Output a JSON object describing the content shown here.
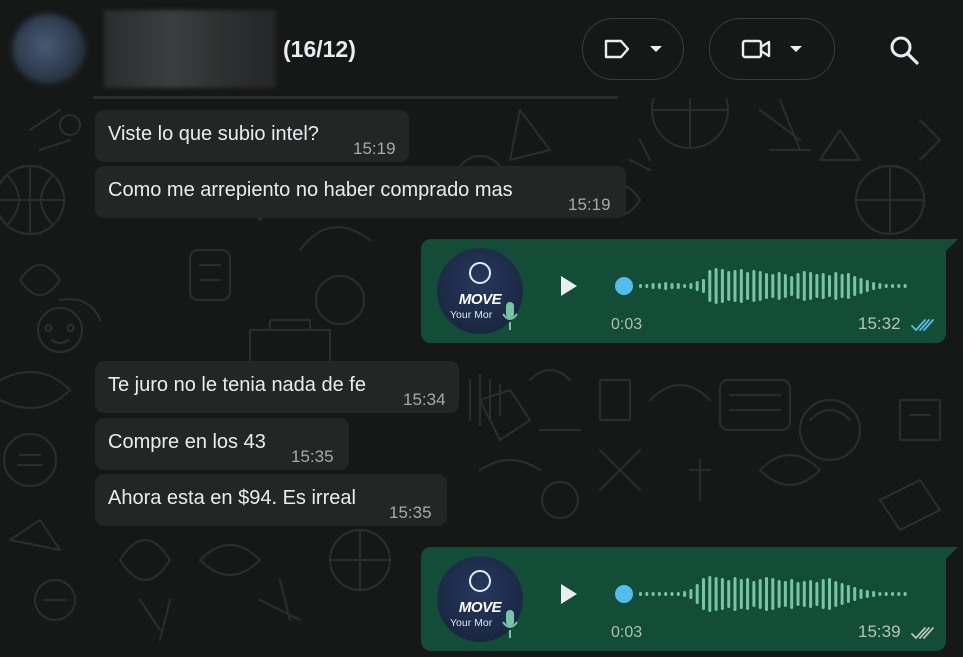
{
  "header": {
    "chat_title": "(16/12)",
    "icons": [
      "label-icon",
      "chevron-down-icon",
      "video-call-icon",
      "chevron-down-icon",
      "search-icon"
    ]
  },
  "messages_in": [
    {
      "text": "Viste lo que subio intel?",
      "time": "15:19"
    },
    {
      "text": "Como me arrepiento no haber comprado mas",
      "time": "15:19"
    },
    {
      "text": "Te juro no le tenia nada de fe",
      "time": "15:34"
    },
    {
      "text": "Compre en los 43",
      "time": "15:35"
    },
    {
      "text": "Ahora esta en $94. Es irreal",
      "time": "15:35"
    }
  ],
  "voice_notes": [
    {
      "brand": "MOVE",
      "brand_sub": "Your Mor",
      "duration": "0:03",
      "time": "15:32",
      "status": "read"
    },
    {
      "brand": "MOVE",
      "brand_sub": "Your Mor",
      "duration": "0:03",
      "time": "15:39",
      "status": "delivered"
    }
  ],
  "colors": {
    "app_bg": "#161717",
    "incoming_bubble": "#242626",
    "outgoing_bubble": "#144d37",
    "accent_blue": "#53bdeb",
    "waveform": "#79c3a8",
    "read_ticks": "#53bdeb",
    "delivered_ticks": "#b4c3bc"
  }
}
